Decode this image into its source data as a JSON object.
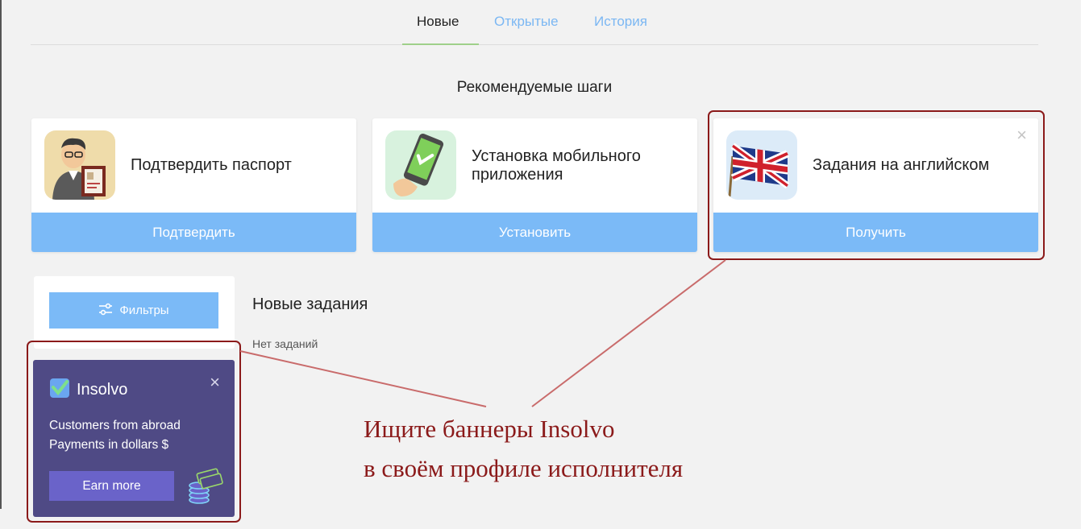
{
  "tabs": [
    {
      "label": "Новые",
      "active": true
    },
    {
      "label": "Открытые",
      "active": false
    },
    {
      "label": "История",
      "active": false
    }
  ],
  "recommended": {
    "title": "Рекомендуемые шаги",
    "cards": [
      {
        "text": "Подтвердить паспорт",
        "button": "Подтвердить",
        "icon": "passport-person-icon"
      },
      {
        "text": "Установка мобильного приложения",
        "button": "Установить",
        "icon": "mobile-phone-check-icon"
      },
      {
        "text": "Задания на английском",
        "button": "Получить",
        "icon": "uk-flag-icon",
        "close": "×"
      }
    ]
  },
  "filters": {
    "button": "Фильтры",
    "icon": "sliders-icon"
  },
  "tasks": {
    "title": "Новые задания",
    "empty": "Нет заданий"
  },
  "banner": {
    "brand": "Insolvo",
    "close": "×",
    "line1": "Customers from abroad",
    "line2": "Payments in dollars $",
    "button": "Earn more",
    "icon": "coin-stacks-icon"
  },
  "annotation": {
    "line1": "Ищите баннеры Insolvo",
    "line2": "в своём профиле исполнителя"
  },
  "colors": {
    "accent": "#7bbaf7",
    "banner_bg": "#4f4a85",
    "banner_button": "#6a63c9",
    "annotation": "#8b1a1a",
    "tab_underline": "#9fd08a"
  }
}
